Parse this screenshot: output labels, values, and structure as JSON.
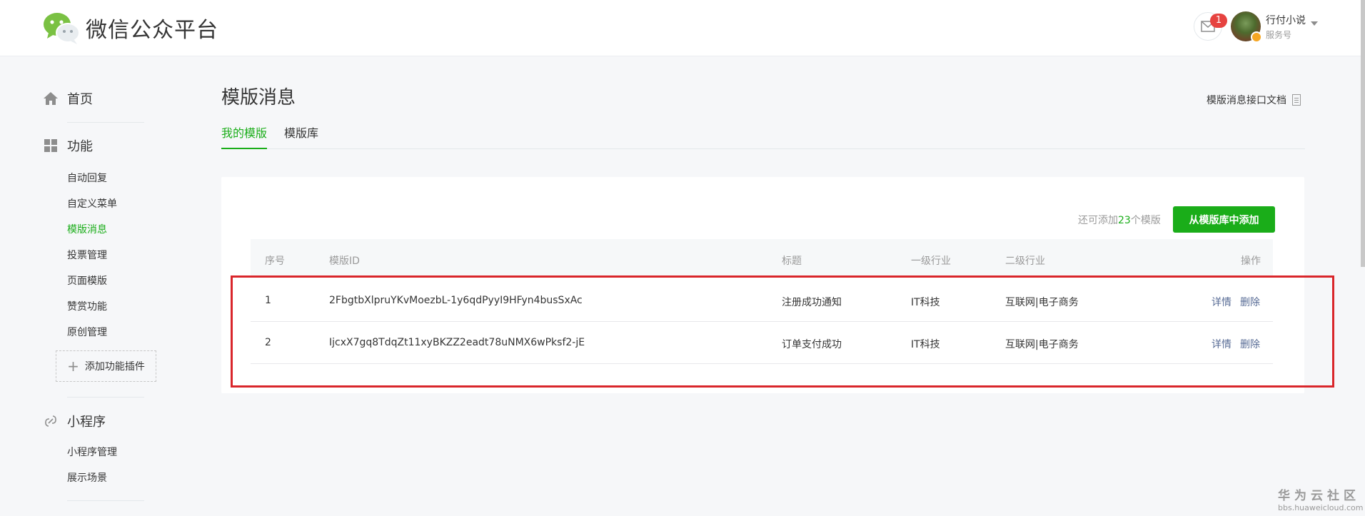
{
  "header": {
    "logo_text": "微信公众平台",
    "mail_badge": "1",
    "account_name": "行付小说",
    "account_type": "服务号"
  },
  "sidebar": {
    "home": "首页",
    "features": "功能",
    "feature_items": [
      "自动回复",
      "自定义菜单",
      "模版消息",
      "投票管理",
      "页面模版",
      "赞赏功能",
      "原创管理"
    ],
    "add_plugin": "添加功能插件",
    "miniprogram": "小程序",
    "miniprogram_items": [
      "小程序管理",
      "展示场景"
    ]
  },
  "main": {
    "title": "模版消息",
    "doc_link": "模版消息接口文档",
    "tabs": [
      "我的模版",
      "模版库"
    ],
    "quota_prefix": "还可添加",
    "quota_count": "23",
    "quota_suffix": "个模版",
    "add_button": "从模版库中添加",
    "table": {
      "headers": [
        "序号",
        "模版ID",
        "标题",
        "一级行业",
        "二级行业",
        "操作"
      ],
      "rows": [
        {
          "no": "1",
          "id": "2FbgtbXlpruYKvMoezbL-1y6qdPyyI9HFyn4busSxAc",
          "title": "注册成功通知",
          "industry1": "IT科技",
          "industry2": "互联网|电子商务",
          "detail": "详情",
          "delete": "删除"
        },
        {
          "no": "2",
          "id": "IjcxX7gq8TdqZt11xyBKZZ2eadt78uNMX6wPksf2-jE",
          "title": "订单支付成功",
          "industry1": "IT科技",
          "industry2": "互联网|电子商务",
          "detail": "详情",
          "delete": "删除"
        }
      ]
    }
  },
  "watermark": {
    "line1": "华为云社区",
    "line2": "bbs.huaweicloud.com"
  },
  "colors": {
    "accent": "#1aad19",
    "link": "#576b95",
    "highlight_box": "#d9262b",
    "badge": "#e64340"
  },
  "icons": [
    "wechat-logo-icon",
    "mail-icon",
    "home-icon",
    "grid-icon",
    "link-icon",
    "plus-icon",
    "document-icon",
    "chevron-down-icon"
  ]
}
